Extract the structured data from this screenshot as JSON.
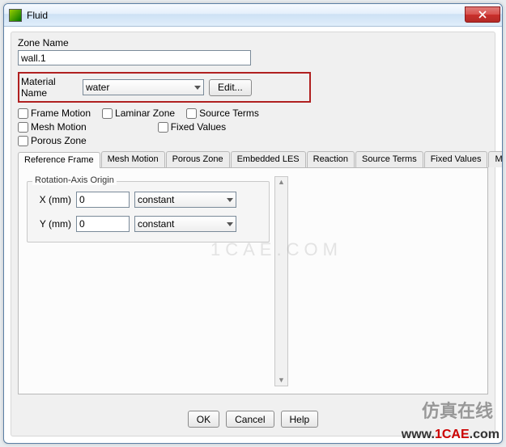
{
  "window": {
    "title": "Fluid"
  },
  "zone": {
    "label": "Zone Name",
    "value": "wall.1"
  },
  "material": {
    "label": "Material Name",
    "value": "water",
    "edit": "Edit..."
  },
  "checks": {
    "frame_motion": "Frame Motion",
    "laminar_zone": "Laminar Zone",
    "source_terms": "Source Terms",
    "mesh_motion": "Mesh Motion",
    "fixed_values": "Fixed Values",
    "porous_zone": "Porous Zone"
  },
  "tabs": {
    "reference": "Reference Frame",
    "mesh_motion": "Mesh Motion",
    "porous_zone": "Porous Zone",
    "embedded_les": "Embedded LES",
    "reaction": "Reaction",
    "source_terms": "Source Terms",
    "fixed_values": "Fixed Values",
    "multiphase": "Multiphase"
  },
  "refframe": {
    "group": "Rotation-Axis Origin",
    "x_label": "X (mm)",
    "x_value": "0",
    "y_label": "Y (mm)",
    "y_value": "0",
    "constant": "constant"
  },
  "footer": {
    "ok": "OK",
    "cancel": "Cancel",
    "help": "Help"
  },
  "watermark": {
    "center": "1CAE.COM",
    "cn": "仿真在线",
    "url_a": "www.",
    "url_b": "1CAE",
    "url_c": ".com"
  }
}
